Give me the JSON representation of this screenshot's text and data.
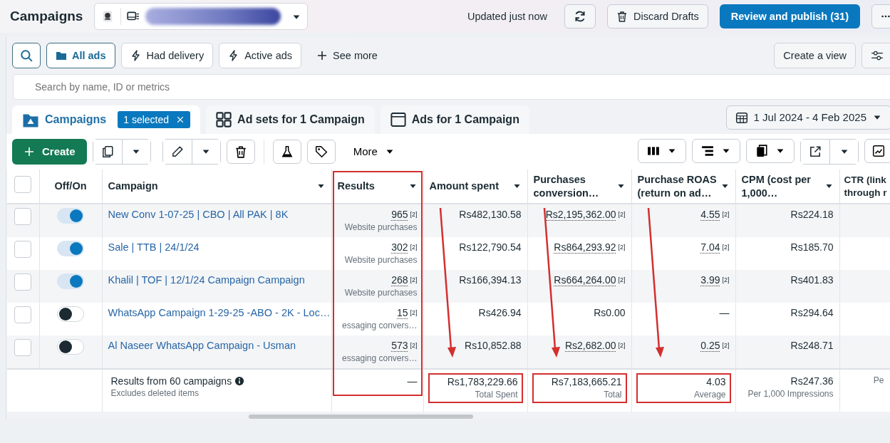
{
  "header": {
    "title": "Campaigns",
    "status": "Updated just now",
    "discard_label": "Discard Drafts",
    "publish_label": "Review and publish (31)"
  },
  "filters": [
    {
      "label": "All ads",
      "selected": true,
      "kind": "folder"
    },
    {
      "label": "Had delivery",
      "selected": false,
      "kind": "bolt"
    },
    {
      "label": "Active ads",
      "selected": false,
      "kind": "bolt"
    },
    {
      "label": "See more",
      "selected": false,
      "kind": "add"
    }
  ],
  "create_view_label": "Create a view",
  "search": {
    "placeholder": "Search by name, ID or metrics"
  },
  "tabs": [
    {
      "label": "Campaigns",
      "selected": true,
      "badge": "1 selected",
      "kind": "campaigns"
    },
    {
      "label": "Ad sets for 1 Campaign",
      "selected": false,
      "kind": "adsets"
    },
    {
      "label": "Ads for 1 Campaign",
      "selected": false,
      "kind": "ads"
    }
  ],
  "date_range": "1 Jul 2024 - 4 Feb 2025",
  "toolbar": {
    "create_label": "Create",
    "more_label": "More"
  },
  "table": {
    "select_all_checked": false,
    "toggle_header": "Off/On",
    "name_header": "Campaign",
    "columns": [
      {
        "label": "Results",
        "framed": true
      },
      {
        "label": "Amount spent",
        "arrowed": true
      },
      {
        "label": "Purchases conversion…",
        "arrowed": true
      },
      {
        "label": "Purchase ROAS (return on ad…",
        "arrowed": true
      },
      {
        "label": "CPM (cost per 1,000…"
      },
      {
        "label": "CTR (link through r"
      }
    ],
    "rows": [
      {
        "checked": false,
        "on": true,
        "name": "New Conv 1-07-25 | CBO | All PAK | 8K",
        "cells": [
          {
            "value": "965",
            "note": "[2]",
            "sub": "Website purchases"
          },
          {
            "value": "Rs482,130.58"
          },
          {
            "value": "Rs2,195,362.00",
            "note": "[2]"
          },
          {
            "value": "4.55",
            "note": "[2]"
          },
          {
            "value": "Rs224.18"
          }
        ]
      },
      {
        "checked": false,
        "on": true,
        "name": "Sale | TTB | 24/1/24",
        "cells": [
          {
            "value": "302",
            "note": "[2]",
            "sub": "Website purchases"
          },
          {
            "value": "Rs122,790.54"
          },
          {
            "value": "Rs864,293.92",
            "note": "[2]"
          },
          {
            "value": "7.04",
            "note": "[2]"
          },
          {
            "value": "Rs185.70"
          }
        ]
      },
      {
        "checked": false,
        "on": true,
        "name": "Khalil | TOF | 12/1/24 Campaign Campaign",
        "cells": [
          {
            "value": "268",
            "note": "[2]",
            "sub": "Website purchases"
          },
          {
            "value": "Rs166,394.13"
          },
          {
            "value": "Rs664,264.00",
            "note": "[2]"
          },
          {
            "value": "3.99",
            "note": "[2]"
          },
          {
            "value": "Rs401.83"
          }
        ]
      },
      {
        "checked": false,
        "on": false,
        "name": "WhatsApp Campaign 1-29-25 -ABO - 2K - Loc…",
        "cells": [
          {
            "value": "15",
            "note": "[2]",
            "sub": "essaging convers…"
          },
          {
            "value": "Rs426.94"
          },
          {
            "value": "Rs0.00"
          },
          {
            "value": "—"
          },
          {
            "value": "Rs294.64"
          }
        ]
      },
      {
        "checked": false,
        "on": false,
        "name": "Al Naseer WhatsApp Campaign - Usman",
        "cells": [
          {
            "value": "573",
            "note": "[2]",
            "sub": "essaging convers…"
          },
          {
            "value": "Rs10,852.88"
          },
          {
            "value": "Rs2,682.00",
            "note": "[2]"
          },
          {
            "value": "0.25",
            "note": "[2]"
          },
          {
            "value": "Rs248.71"
          }
        ]
      }
    ],
    "totals": {
      "label": "Results from 60 campaigns",
      "sub": "Excludes deleted items",
      "cells": [
        {
          "value": "—"
        },
        {
          "value": "Rs1,783,229.66",
          "sub": "Total Spent"
        },
        {
          "value": "Rs7,183,665.21",
          "sub": "Total"
        },
        {
          "value": "4.03",
          "sub": "Average"
        },
        {
          "value": "Rs247.36",
          "sub": "Per 1,000 Impressions"
        },
        {
          "sub": "Pe"
        }
      ]
    }
  }
}
